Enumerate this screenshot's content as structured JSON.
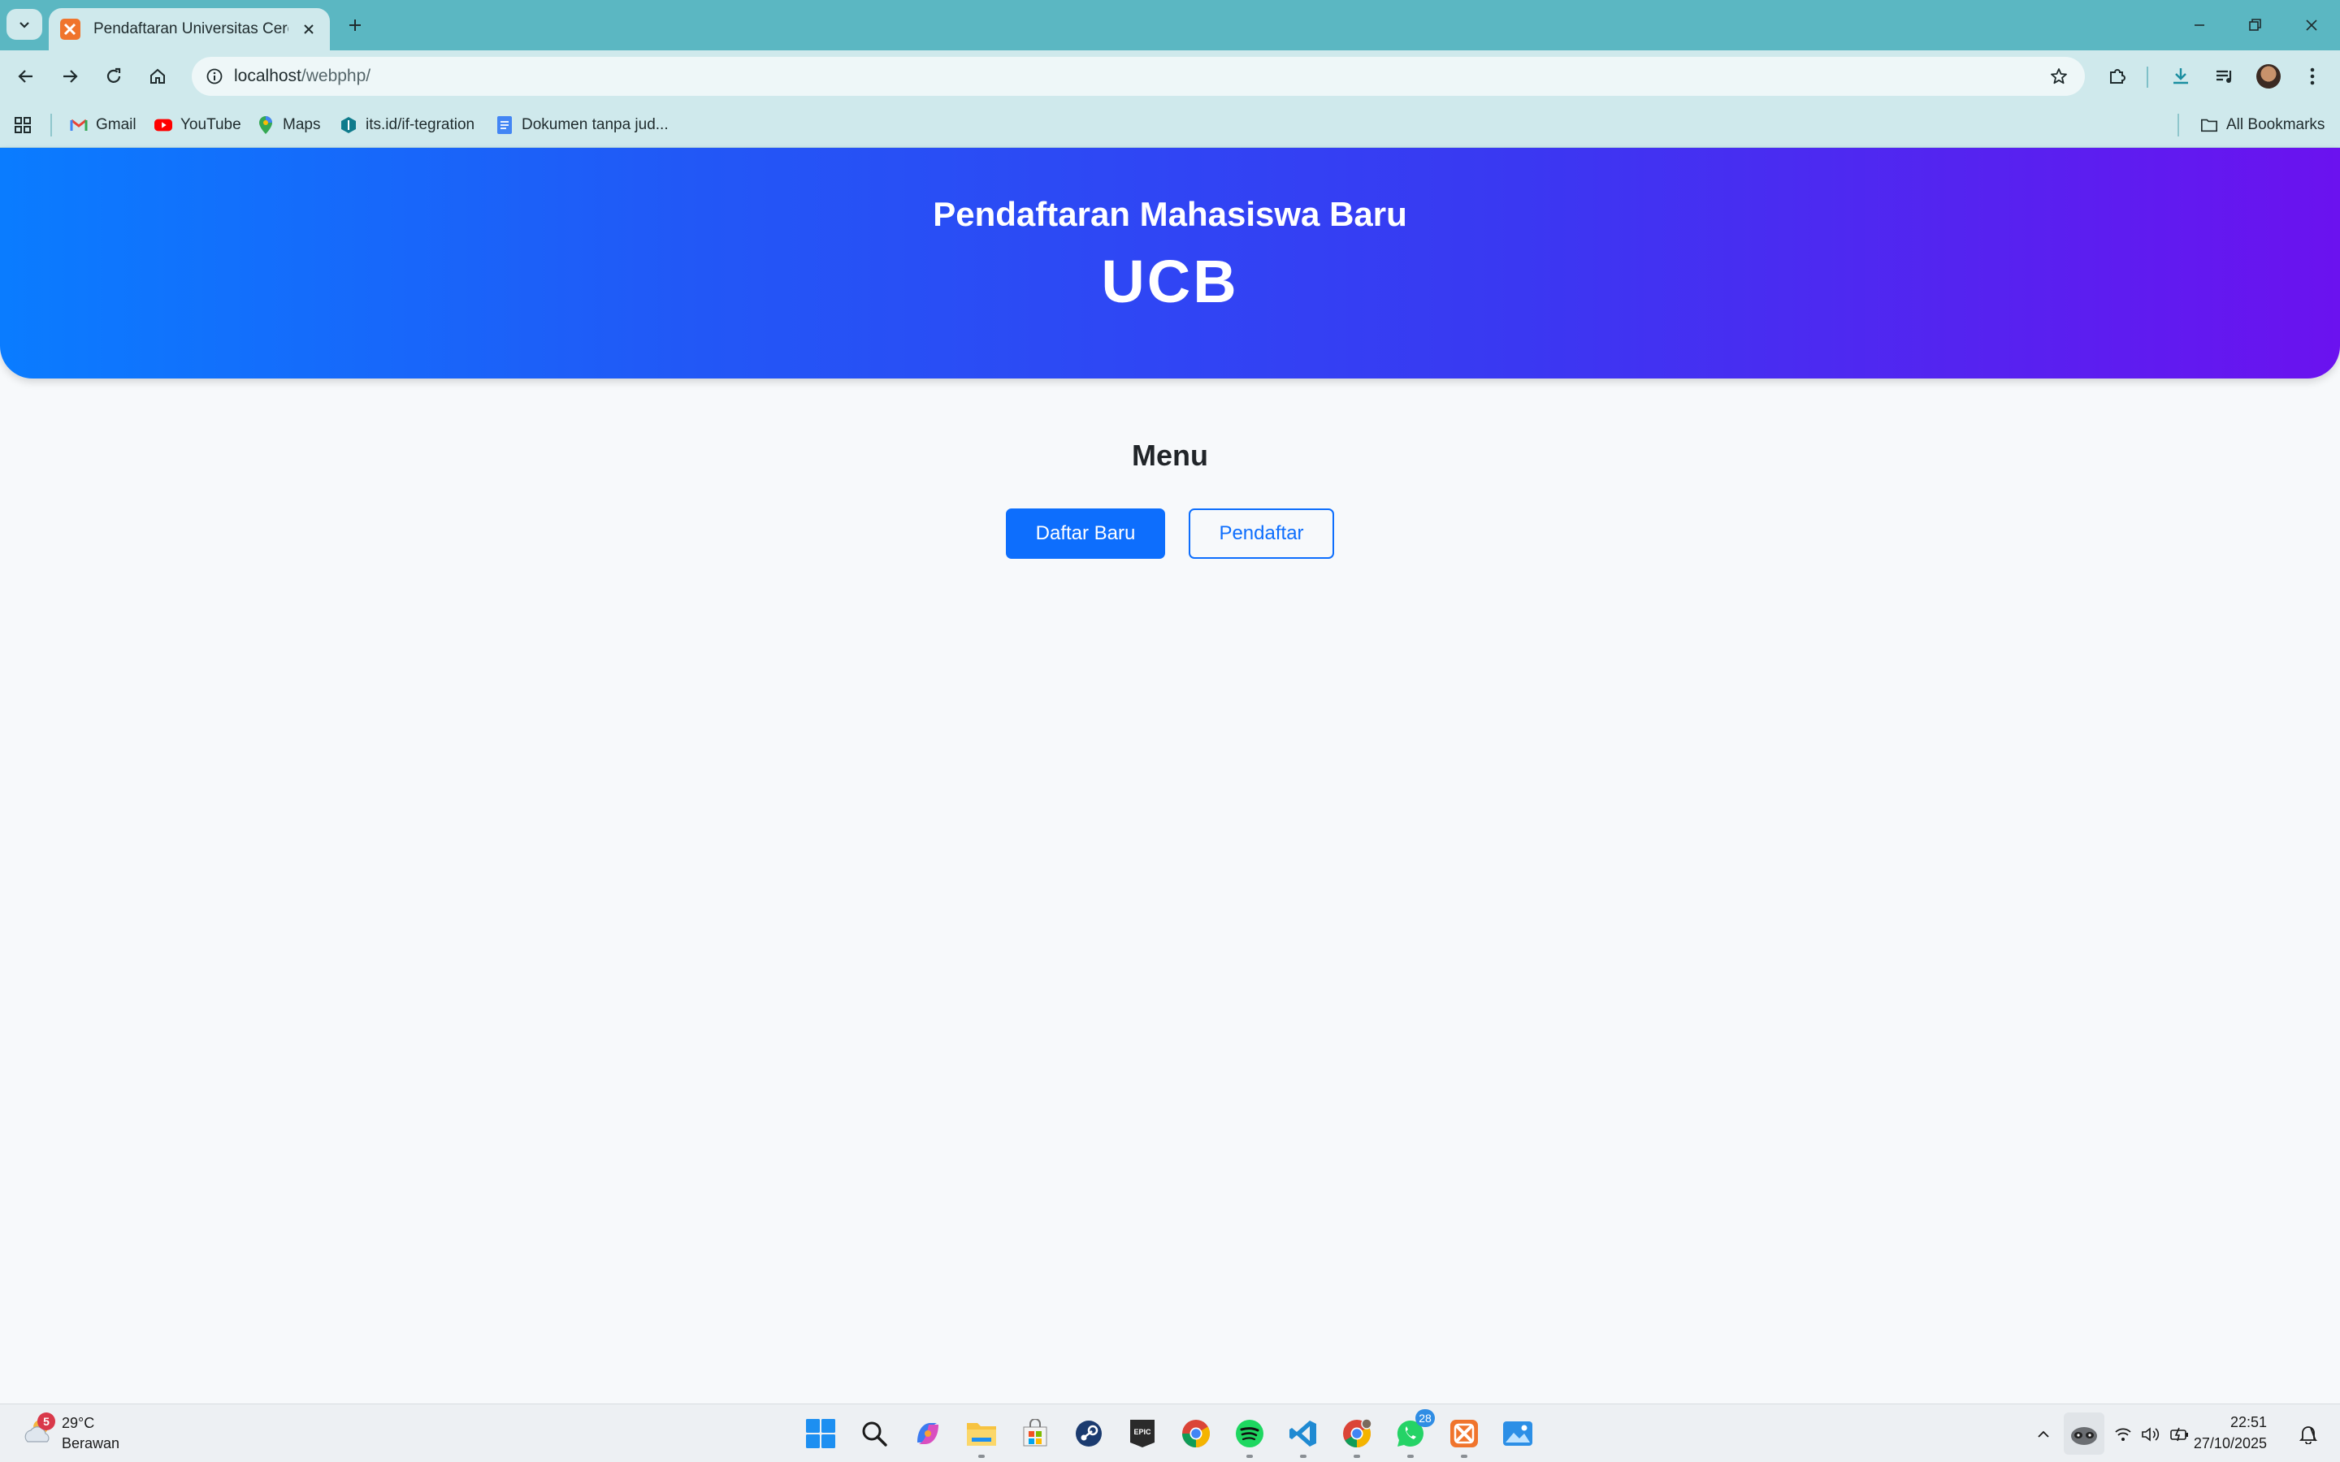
{
  "browser": {
    "tab_title": "Pendaftaran Universitas Cerdas",
    "url_host": "localhost",
    "url_path": "/webphp/",
    "bookmarks": [
      {
        "label": "Gmail",
        "icon": "gmail-icon"
      },
      {
        "label": "YouTube",
        "icon": "youtube-icon"
      },
      {
        "label": "Maps",
        "icon": "maps-icon"
      },
      {
        "label": "its.id/if-tegration",
        "icon": "its-icon"
      },
      {
        "label": "Dokumen tanpa jud...",
        "icon": "docs-icon"
      }
    ],
    "all_bookmarks": "All Bookmarks"
  },
  "page": {
    "hero_title": "Pendaftaran Mahasiswa Baru",
    "hero_university": "UCB",
    "menu_heading": "Menu",
    "btn_primary": "Daftar Baru",
    "btn_outline": "Pendaftar"
  },
  "colors": {
    "hero_gradient_start": "#0a7cff",
    "hero_gradient_end": "#6b12ef",
    "primary": "#0d6efd"
  },
  "taskbar": {
    "weather_temp": "29°C",
    "weather_desc": "Berawan",
    "weather_badge": "5",
    "whatsapp_badge": "28",
    "time": "22:51",
    "date": "27/10/2025"
  }
}
